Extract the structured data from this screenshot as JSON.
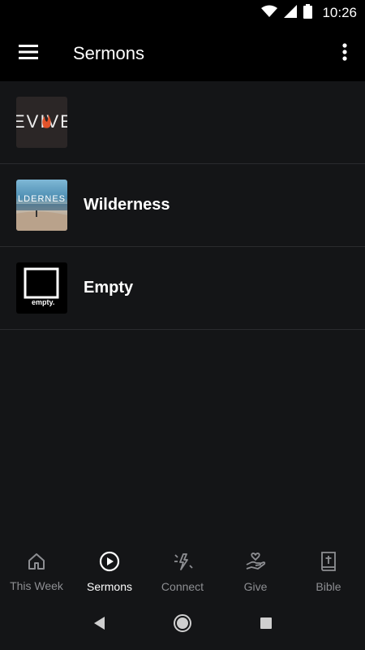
{
  "status_bar": {
    "time": "10:26",
    "icons": [
      "wifi-icon",
      "signal-icon",
      "battery-icon"
    ]
  },
  "app_bar": {
    "title": "Sermons",
    "menu_icon": "hamburger-menu-icon",
    "overflow_icon": "more-vert-icon"
  },
  "sermons": [
    {
      "label": "",
      "thumb_text": "EVIVE",
      "thumb_type": "revive"
    },
    {
      "label": "Wilderness",
      "thumb_text": "ILDERNES",
      "thumb_type": "wilderness"
    },
    {
      "label": "Empty",
      "thumb_text": "empty.",
      "thumb_type": "empty"
    }
  ],
  "bottom_nav": [
    {
      "label": "This Week",
      "icon": "home-icon",
      "active": false
    },
    {
      "label": "Sermons",
      "icon": "play-circle-icon",
      "active": true
    },
    {
      "label": "Connect",
      "icon": "sparkle-icon",
      "active": false
    },
    {
      "label": "Give",
      "icon": "give-heart-hand-icon",
      "active": false
    },
    {
      "label": "Bible",
      "icon": "bible-icon",
      "active": false
    }
  ],
  "system_nav": [
    "back-icon",
    "home-circle-icon",
    "recents-icon"
  ],
  "colors": {
    "background": "#141517",
    "bar": "#000000",
    "divider": "#2a2b2e",
    "inactive": "#8d8e92",
    "active": "#ffffff",
    "flame": "#e2532b"
  }
}
